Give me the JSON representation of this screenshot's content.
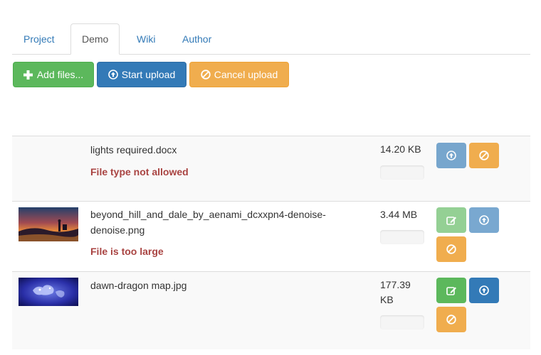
{
  "tabs": [
    {
      "label": "Project",
      "active": false
    },
    {
      "label": "Demo",
      "active": true
    },
    {
      "label": "Wiki",
      "active": false
    },
    {
      "label": "Author",
      "active": false
    }
  ],
  "toolbar": {
    "add_label": "Add files...",
    "add_icon": "plus-icon",
    "start_label": "Start upload",
    "start_icon": "upload-circle-icon",
    "cancel_label": "Cancel upload",
    "cancel_icon": "ban-icon"
  },
  "files": [
    {
      "name": "lights required.docx",
      "size": "14.20 KB",
      "error": "File type not allowed",
      "thumbnail": null,
      "progress": 0,
      "actions": [
        {
          "icon": "upload-circle-icon",
          "style": "primary",
          "disabled": true
        },
        {
          "icon": "ban-icon",
          "style": "warning",
          "disabled": false
        }
      ]
    },
    {
      "name": "beyond_hill_and_dale_by_aenami_dcxxpn4-denoise-denoise.png",
      "size": "3.44 MB",
      "error": "File is too large",
      "thumbnail": "sunset-landscape",
      "progress": 0,
      "actions": [
        {
          "icon": "edit-icon",
          "style": "success",
          "disabled": true
        },
        {
          "icon": "upload-circle-icon",
          "style": "primary",
          "disabled": true
        },
        {
          "icon": "ban-icon",
          "style": "warning",
          "disabled": false
        }
      ]
    },
    {
      "name": "dawn-dragon map.jpg",
      "size": "177.39 KB",
      "error": "",
      "thumbnail": "blue-map",
      "progress": 0,
      "actions": [
        {
          "icon": "edit-icon",
          "style": "success",
          "disabled": false
        },
        {
          "icon": "upload-circle-icon",
          "style": "primary",
          "disabled": false
        },
        {
          "icon": "ban-icon",
          "style": "warning",
          "disabled": false
        }
      ]
    }
  ],
  "colors": {
    "success": "#5cb85c",
    "primary": "#337ab7",
    "warning": "#f0ad4e",
    "error_text": "#a94442",
    "link": "#337ab7"
  }
}
